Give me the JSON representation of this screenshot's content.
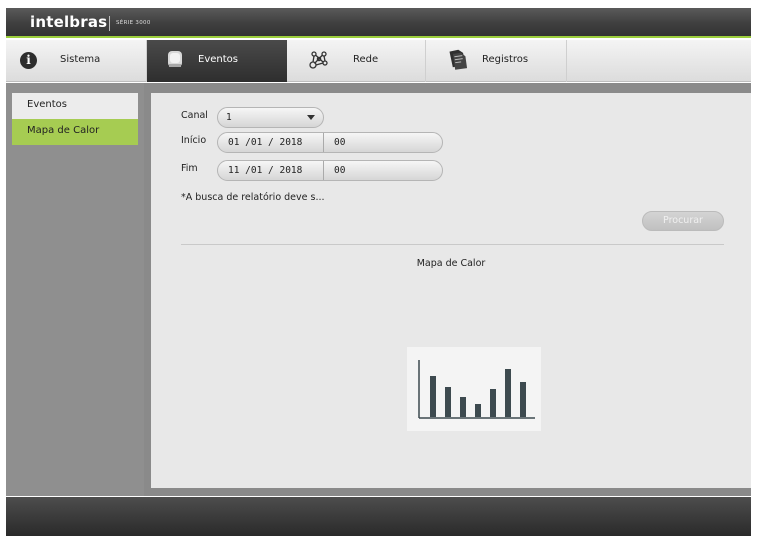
{
  "header": {
    "brand": "intelbras",
    "series": "SÉRIE 3000"
  },
  "tabs": [
    {
      "label": "Sistema",
      "icon": "info-icon"
    },
    {
      "label": "Eventos",
      "icon": "alarm-icon",
      "active": true
    },
    {
      "label": "Rede",
      "icon": "network-icon"
    },
    {
      "label": "Registros",
      "icon": "documents-icon"
    }
  ],
  "sidebar": {
    "items": [
      {
        "label": "Eventos"
      },
      {
        "label": "Mapa de Calor",
        "selected": true
      }
    ]
  },
  "form": {
    "canal_label": "Canal",
    "canal_value": "1",
    "inicio_label": "Início",
    "inicio_date": "01 /01 / 2018",
    "inicio_time": "00",
    "fim_label": "Fim",
    "fim_date": "11 /01 / 2018",
    "fim_time": "00",
    "note": "*A busca de relatório deve s...",
    "search_button": "Procurar"
  },
  "result": {
    "title": "Mapa de Calor",
    "placeholder_icon": "bar-chart-icon"
  },
  "colors": {
    "accent_green": "#a6cc52",
    "header_line": "#9ccf3c",
    "dark_bar": "#333333",
    "icon_bars": "#3d4a4f"
  }
}
